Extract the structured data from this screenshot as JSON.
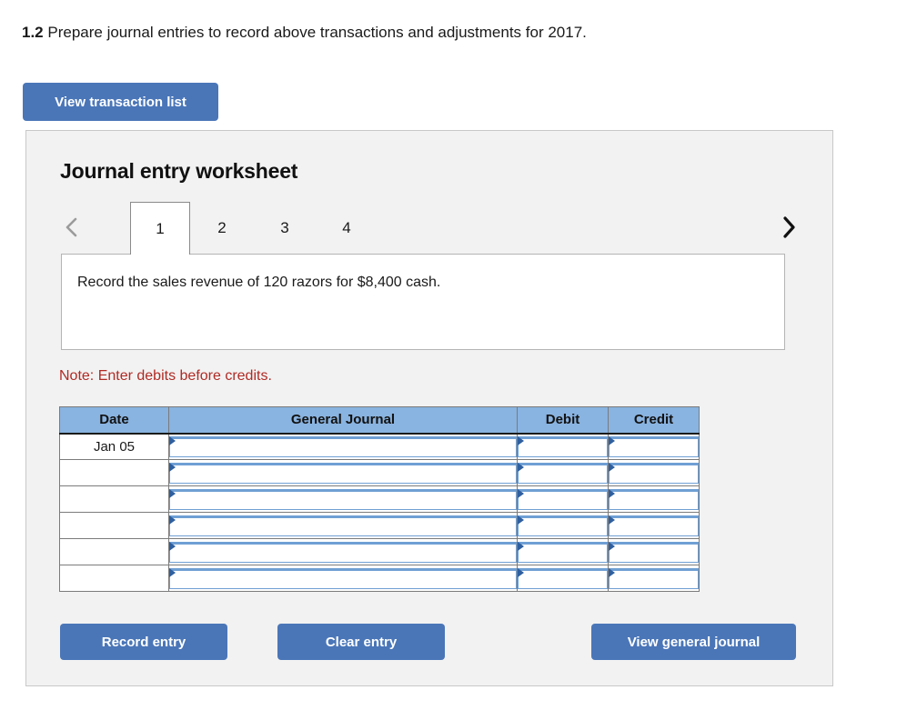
{
  "question": {
    "number": "1.2",
    "text": "Prepare journal entries to record above transactions and adjustments for 2017."
  },
  "toolbar": {
    "view_transaction_list_label": "View transaction list"
  },
  "worksheet": {
    "title": "Journal entry worksheet",
    "nav": {
      "prev_icon": "chevron-left-icon",
      "next_icon": "chevron-right-icon"
    },
    "tabs": [
      {
        "label": "1",
        "active": true
      },
      {
        "label": "2",
        "active": false
      },
      {
        "label": "3",
        "active": false
      },
      {
        "label": "4",
        "active": false
      }
    ],
    "description": "Record the sales revenue of 120 razors for $8,400 cash.",
    "note": "Note: Enter debits before credits.",
    "note_color": "#b02a24",
    "table": {
      "headers": [
        "Date",
        "General Journal",
        "Debit",
        "Credit"
      ],
      "header_bg": "#89b3e0",
      "rows": [
        {
          "date": "Jan 05",
          "general_journal": "",
          "debit": "",
          "credit": ""
        },
        {
          "date": "",
          "general_journal": "",
          "debit": "",
          "credit": ""
        },
        {
          "date": "",
          "general_journal": "",
          "debit": "",
          "credit": ""
        },
        {
          "date": "",
          "general_journal": "",
          "debit": "",
          "credit": ""
        },
        {
          "date": "",
          "general_journal": "",
          "debit": "",
          "credit": ""
        },
        {
          "date": "",
          "general_journal": "",
          "debit": "",
          "credit": ""
        }
      ]
    },
    "actions": {
      "record_entry_label": "Record entry",
      "clear_entry_label": "Clear entry",
      "view_general_journal_label": "View general journal"
    },
    "accent_color": "#4a76b8"
  }
}
